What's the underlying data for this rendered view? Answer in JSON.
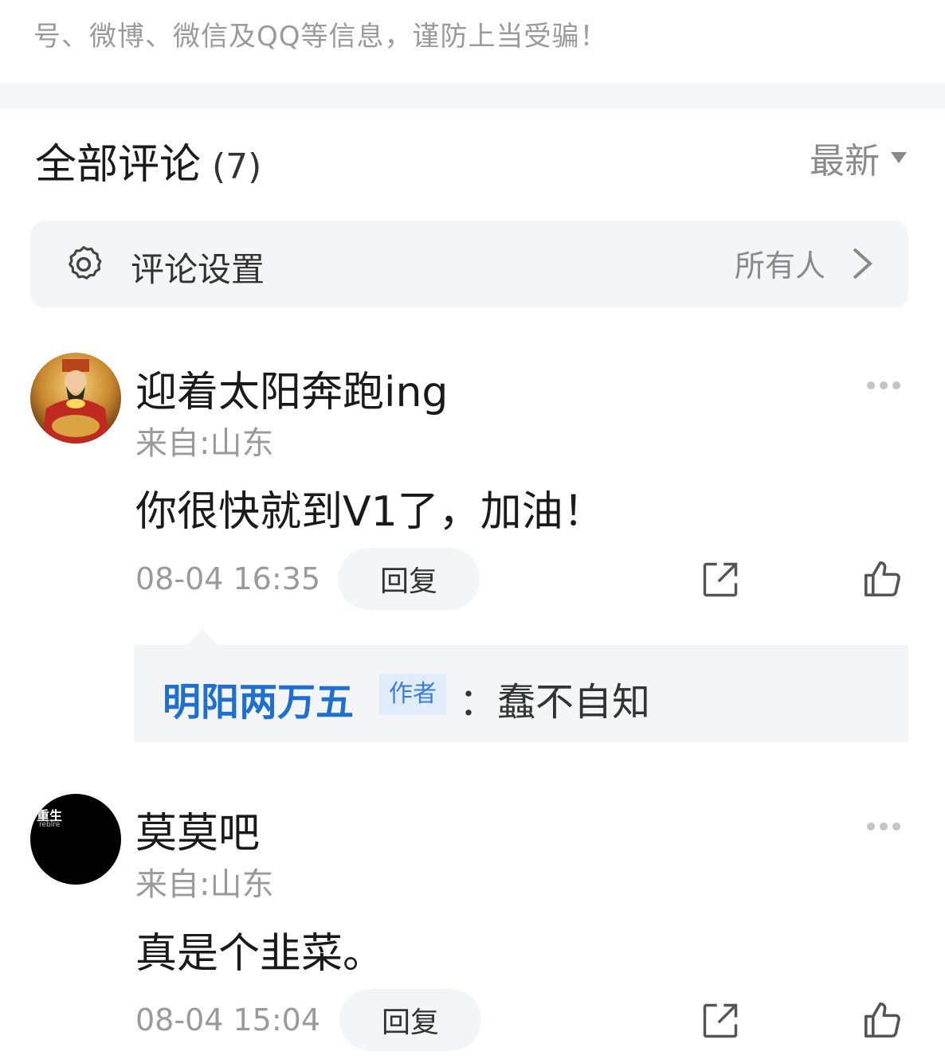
{
  "notice": "号、微博、微信及QQ等信息，谨防上当受骗！",
  "comments_header": {
    "title": "全部评论",
    "count": "(7)",
    "sort_label": "最新"
  },
  "settings": {
    "label": "评论设置",
    "value": "所有人"
  },
  "comments": [
    {
      "username": "迎着太阳奔跑ing",
      "location": "来自:山东",
      "content": "你很快就到V1了，加油！",
      "timestamp": "08-04 16:35",
      "reply_label": "回复",
      "reply": {
        "author": "明阳两万五",
        "badge": "作者",
        "text": "：蠢不自知"
      }
    },
    {
      "username": "莫莫吧",
      "location": "来自:山东",
      "content": "真是个韭菜。",
      "timestamp": "08-04 15:04",
      "reply_label": "回复",
      "avatar_text": "重生",
      "avatar_subtext": "reblre"
    }
  ],
  "colors": {
    "link_blue": "#1f6fd0",
    "muted_gray": "#9a9a9a",
    "panel_bg": "#f4f5f7"
  },
  "icons": [
    "gear-icon",
    "chevron-right-icon",
    "more-icon",
    "share-icon",
    "thumbs-up-icon",
    "sort-down-icon"
  ]
}
